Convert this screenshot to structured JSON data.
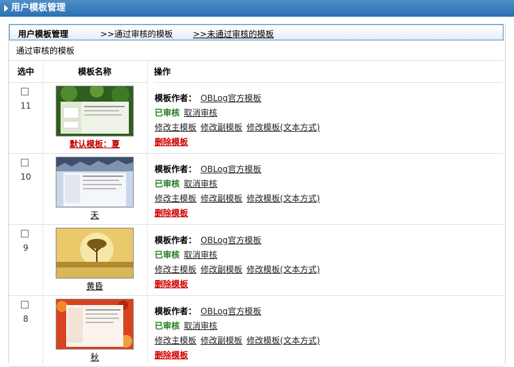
{
  "window": {
    "title": "用户模板管理"
  },
  "tabs": {
    "manage": "用户模板管理",
    "approved": ">>通过审核的模板",
    "unapproved": ">>未通过审核的模板"
  },
  "section_title": "通过审核的模板",
  "columns": {
    "select": "选中",
    "name": "模板名称",
    "ops": "操作"
  },
  "ops_labels": {
    "author": "模板作者：",
    "approved": "已审核",
    "cancel": "取消审核",
    "edit_main": "修改主模板",
    "edit_sub": "修改副模板",
    "edit_text": "修改模板(文本方式)",
    "delete": "删除模板"
  },
  "rows": [
    {
      "id": "11",
      "name": "默认模板：夏",
      "author": "OBLog官方模板",
      "thumb": "green-lotus",
      "default": true
    },
    {
      "id": "10",
      "name": "天",
      "author": "OBLog官方模板",
      "thumb": "blue-sky",
      "default": false
    },
    {
      "id": "9",
      "name": "黄昏",
      "author": "OBLog官方模板",
      "thumb": "golden-tree",
      "default": false
    },
    {
      "id": "8",
      "name": "秋",
      "author": "OBLog官方模板",
      "thumb": "autumn-leaves",
      "default": false
    }
  ]
}
